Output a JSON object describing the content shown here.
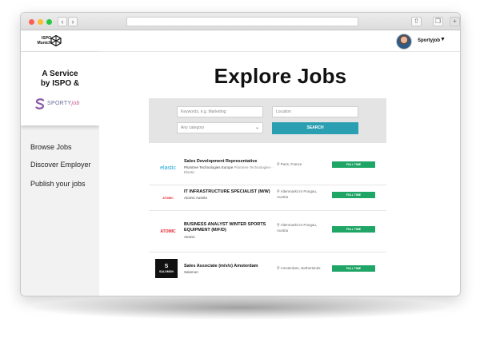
{
  "header": {
    "logo_line1": "ISPO",
    "logo_line2": "Munich",
    "user_name": "Sportyjob"
  },
  "sidebar": {
    "service_line1": "A Service",
    "service_line2": "by ISPO &",
    "sporty_brand": "SPORTY",
    "sporty_brand_suffix": "job",
    "links": [
      {
        "label": "Browse Jobs"
      },
      {
        "label": "Discover Employer"
      },
      {
        "label": "Publish your jobs"
      }
    ]
  },
  "main": {
    "title": "Explore Jobs",
    "search": {
      "keyword_placeholder": "Keywords, e.g. Marketing",
      "location_placeholder": "Location",
      "category_value": "Any category",
      "search_label": "SEARCH"
    },
    "jobs": [
      {
        "logo": "elastic",
        "logo_color": "#1ba6d8",
        "title": "Sales Development Representative",
        "company": "Plumtree Technologies Europe",
        "company_extra": "Plumtree Technologies - Elastic",
        "location": "Paris, France",
        "type": "FULL TIME"
      },
      {
        "logo": "ATOMIC",
        "logo_color": "#e3262f",
        "title": "IT INFRASTRUCTURE SPECIALIST (M/W)",
        "company": "Atomic Austria",
        "company_extra": "",
        "location": "Altenmarkt im Pongau, Austria",
        "type": "FULL TIME"
      },
      {
        "logo": "ATOMIC",
        "logo_color": "#e3262f",
        "title": "BUSINESS ANALYST WINTER SPORTS EQUIPMENT (M/F/D)",
        "company": "Atomic",
        "company_extra": "",
        "location": "Altenmarkt im Pongau, Austria",
        "type": "FULL TIME"
      },
      {
        "logo": "SALOMON",
        "logo_color": "#111111",
        "title": "Sales Associate (m/v/x) Amsterdam",
        "company": "Salomon",
        "company_extra": "",
        "location": "Amsterdam, Netherlands",
        "type": "FULL TIME"
      }
    ]
  },
  "colors": {
    "search_button": "#2b9fb2",
    "badge": "#1fa566",
    "sidebar_bg": "#f2f2f2",
    "search_panel_bg": "#e4e4e4"
  }
}
